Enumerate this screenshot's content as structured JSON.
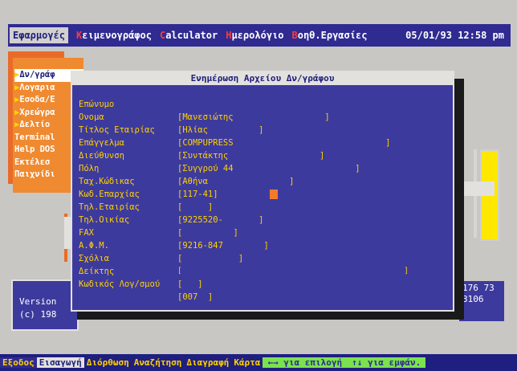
{
  "menubar": {
    "items": [
      {
        "pre": "",
        "hot": "",
        "rest": "Εφαρμογές"
      },
      {
        "pre": "",
        "hot": "Κ",
        "rest": "ειμενογράφος"
      },
      {
        "pre": "",
        "hot": "C",
        "rest": "alculator"
      },
      {
        "pre": "",
        "hot": "Η",
        "rest": "μερολόγιο"
      },
      {
        "pre": "",
        "hot": "Β",
        "rest": "οηθ.Εργασίες"
      }
    ],
    "date": "05/01/93 12:58 pm"
  },
  "leftmenu": [
    {
      "label": "Δν/γράφ",
      "selected": true
    },
    {
      "label": "Λογαρια",
      "selected": false
    },
    {
      "label": "Εσοδα/Ε",
      "selected": false
    },
    {
      "label": "Χρεώγρα",
      "selected": false
    },
    {
      "label": "Δελτίο",
      "selected": false
    },
    {
      "label": "Terminal",
      "selected": false
    },
    {
      "label": "Help DOS",
      "selected": false
    },
    {
      "label": "Εκτέλεσ",
      "selected": false
    },
    {
      "label": "Παιχνίδι",
      "selected": false
    }
  ],
  "window": {
    "title": "Ενημέρωση Αρχείου Δν/γράφου",
    "fields": [
      {
        "label": "Επώνυμο",
        "value": "[Μανεσιώτης                  ]"
      },
      {
        "label": "Ονομα",
        "value": "[Ηλίας          ]"
      },
      {
        "label": "Τίτλος Εταιρίας",
        "value": "[COMPUPRESS                              ]"
      },
      {
        "label": "Επάγγελμα",
        "value": "[Συντάκτης                  ]"
      },
      {
        "label": "Διεύθυνση",
        "value": "[Συγγρού 44                        ]"
      },
      {
        "label": "Πόλη",
        "value": "[Αθήνα                ]"
      },
      {
        "label": "Ταχ.Κώδικας",
        "value": "[117-41]"
      },
      {
        "label": "Κωδ.Επαρχίας",
        "value": "[     ]"
      },
      {
        "label": "Τηλ.Εταιρίας",
        "value": "[9225520-       ]"
      },
      {
        "label": "Τηλ.Οικίας",
        "value": "[          ]"
      },
      {
        "label": "FAX",
        "value": "[9216-847        ]"
      },
      {
        "label": "Α.Φ.Μ.",
        "value": "[           ]"
      },
      {
        "label": "Σχόλια",
        "value": "[                                                 ]"
      },
      {
        "label": "Δείκτης",
        "value": "[   ]"
      },
      {
        "label": "Κωδικός Λογ/σμού",
        "value": "[007  ]"
      }
    ]
  },
  "version": {
    "line1": "Version",
    "line2": "(c) 198"
  },
  "right_info": {
    "line1": "176 73",
    "line2": "3106"
  },
  "statusbar": {
    "items": [
      "Εξοδος",
      "Εισαγωγή",
      "Διόρθωση",
      "Αναζήτηση",
      "Διαγραφή",
      "Κάρτα"
    ],
    "help1": "←→ για επιλογή",
    "help2": "↑↓ για εμφάν."
  },
  "colors": {
    "background": "#3d3a9e",
    "field_text": "#ffd100",
    "accent": "#e96b2a"
  }
}
